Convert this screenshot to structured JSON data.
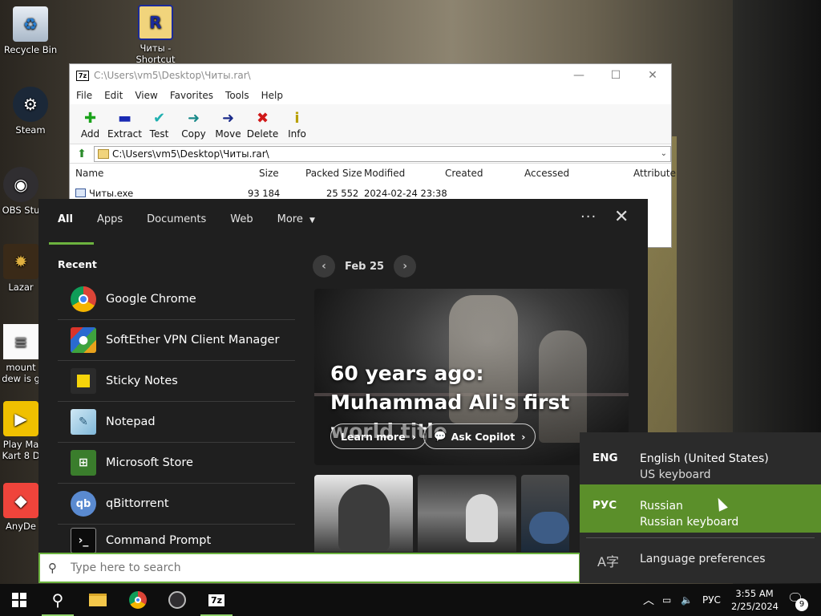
{
  "desktop": {
    "icons": [
      {
        "label": "Recycle Bin",
        "icon": "recycle-bin-icon"
      },
      {
        "label": "Читы -\nShortcut",
        "icon": "winrar-shortcut-icon"
      },
      {
        "label": "Steam",
        "icon": "steam-icon"
      },
      {
        "label": "OBS Stu",
        "icon": "obs-icon"
      },
      {
        "label": "Lazar",
        "icon": "lazarus-icon"
      },
      {
        "label": "mount\ndew is g",
        "icon": "text-file-icon"
      },
      {
        "label": "Play Ma\nKart 8 D",
        "icon": "game-shortcut-icon"
      },
      {
        "label": "AnyDe",
        "icon": "anydesk-icon"
      }
    ]
  },
  "sevenzip": {
    "title": "C:\\Users\\vm5\\Desktop\\Читы.rar\\",
    "menu": [
      "File",
      "Edit",
      "View",
      "Favorites",
      "Tools",
      "Help"
    ],
    "toolbar": [
      {
        "label": "Add",
        "icon": "add-icon",
        "color": "#1aa31a"
      },
      {
        "label": "Extract",
        "icon": "extract-icon",
        "color": "#1a2ab3"
      },
      {
        "label": "Test",
        "icon": "test-icon",
        "color": "#20b0b0"
      },
      {
        "label": "Copy",
        "icon": "copy-icon",
        "color": "#1a8a8a"
      },
      {
        "label": "Move",
        "icon": "move-icon",
        "color": "#1a2a8a"
      },
      {
        "label": "Delete",
        "icon": "delete-icon",
        "color": "#d01818"
      },
      {
        "label": "Info",
        "icon": "info-icon",
        "color": "#b8a000"
      }
    ],
    "address": "C:\\Users\\vm5\\Desktop\\Читы.rar\\",
    "columns": [
      "Name",
      "Size",
      "Packed Size",
      "Modified",
      "Created",
      "Accessed",
      "Attribute"
    ],
    "rows": [
      {
        "name": "Читы.exe",
        "size": "93 184",
        "packed": "25 552",
        "modified": "2024-02-24 23:38"
      }
    ]
  },
  "search": {
    "tabs": [
      "All",
      "Apps",
      "Documents",
      "Web",
      "More"
    ],
    "recent_label": "Recent",
    "recent": [
      {
        "label": "Google Chrome",
        "icon": "chrome-icon"
      },
      {
        "label": "SoftEther VPN Client Manager",
        "icon": "softether-icon"
      },
      {
        "label": "Sticky Notes",
        "icon": "sticky-notes-icon"
      },
      {
        "label": "Notepad",
        "icon": "notepad-icon"
      },
      {
        "label": "Microsoft Store",
        "icon": "store-icon"
      },
      {
        "label": "qBittorrent",
        "icon": "qbittorrent-icon"
      },
      {
        "label": "Command Prompt",
        "icon": "cmd-icon"
      }
    ],
    "date": "Feb 25",
    "hero_title": "60 years ago: Muhammad Ali's first world title",
    "learn_more": "Learn more",
    "ask_copilot": "Ask Copilot",
    "placeholder": "Type here to search"
  },
  "language": {
    "items": [
      {
        "code": "ENG",
        "name": "English (United States)",
        "keyboard": "US keyboard"
      },
      {
        "code": "РУС",
        "name": "Russian",
        "keyboard": "Russian keyboard"
      }
    ],
    "preferences": "Language preferences"
  },
  "taskbar": {
    "lang": "РУС",
    "time": "3:55 AM",
    "date": "2/25/2024",
    "notifications": "9"
  }
}
